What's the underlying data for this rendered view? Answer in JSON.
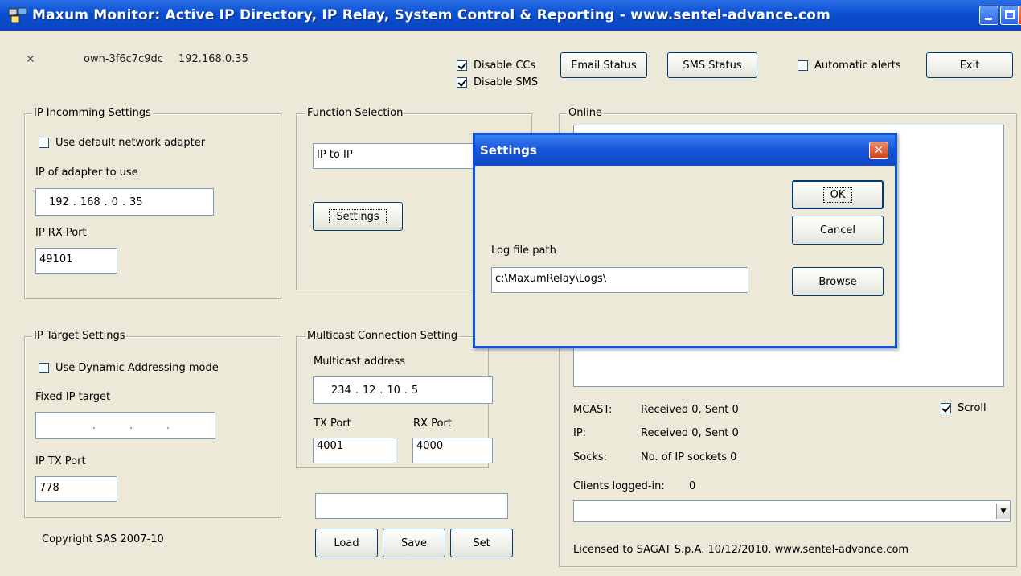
{
  "window": {
    "title": "Maxum Monitor: Active IP Directory, IP Relay, System Control & Reporting - www.sentel-advance.com"
  },
  "header": {
    "status_symbol": "✕",
    "host": "own-3f6c7c9dc",
    "ip": "192.168.0.35",
    "disable_ccs_label": "Disable CCs",
    "disable_ccs_checked": true,
    "disable_sms_label": "Disable SMS",
    "disable_sms_checked": true,
    "email_status_label": "Email Status",
    "sms_status_label": "SMS Status",
    "automatic_alerts_label": "Automatic alerts",
    "automatic_alerts_checked": false,
    "exit_label": "Exit"
  },
  "ip_incoming": {
    "legend": "IP Incomming Settings",
    "use_default_adapter_label": "Use default network adapter",
    "use_default_adapter_checked": false,
    "adapter_ip_label": "IP of adapter to use",
    "adapter_ip": [
      "192",
      "168",
      "0",
      "35"
    ],
    "rx_port_label": "IP RX Port",
    "rx_port": "49101"
  },
  "function_selection": {
    "legend": "Function Selection",
    "selected": "IP to IP",
    "settings_label": "Settings"
  },
  "ip_target": {
    "legend": "IP Target Settings",
    "dynamic_label": "Use Dynamic Addressing mode",
    "dynamic_checked": false,
    "fixed_ip_label": "Fixed IP target",
    "fixed_ip": [
      "",
      "",
      "",
      ""
    ],
    "tx_port_label": "IP TX Port",
    "tx_port": "778"
  },
  "multicast": {
    "legend": "Multicast Connection Setting",
    "address_label": "Multicast address",
    "address": [
      "234",
      "12",
      "10",
      "5"
    ],
    "tx_port_label": "TX Port",
    "tx_port": "4001",
    "rx_port_label": "RX Port",
    "rx_port": "4000"
  },
  "config": {
    "name_value": "",
    "load_label": "Load",
    "save_label": "Save",
    "set_label": "Set"
  },
  "online": {
    "legend": "Online",
    "mcast_label": "MCAST:",
    "mcast_value": "Received 0, Sent 0",
    "ip_label": "IP:",
    "ip_value": "Received 0, Sent 0",
    "socks_label": "Socks:",
    "socks_value": "No. of IP sockets 0",
    "scroll_label": "Scroll",
    "scroll_checked": true,
    "clients_label": "Clients logged-in:",
    "clients_value": "0",
    "clients_selected": "",
    "license": "Licensed to SAGAT S.p.A. 10/12/2010. www.sentel-advance.com"
  },
  "copyright": "Copyright SAS 2007-10",
  "settings_dialog": {
    "title": "Settings",
    "ok_label": "OK",
    "cancel_label": "Cancel",
    "log_path_label": "Log file path",
    "log_path": "c:\\MaxumRelay\\Logs\\",
    "browse_label": "Browse"
  }
}
